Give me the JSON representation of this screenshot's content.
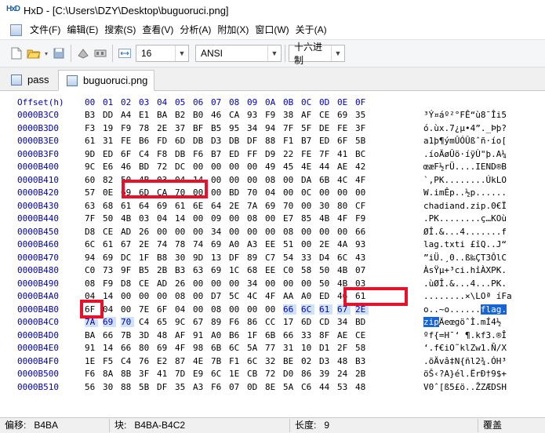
{
  "window": {
    "app_logo": "HxD",
    "title": "HxD - [C:\\Users\\DZY\\Desktop\\buguoruci.png]"
  },
  "menu": [
    "文件(F)",
    "编辑(E)",
    "搜索(S)",
    "查看(V)",
    "分析(A)",
    "附加(X)",
    "窗口(W)",
    "关于(A)"
  ],
  "toolbar": {
    "bytes_per_row": "16",
    "charset": "ANSI",
    "display_mode": "十六进制"
  },
  "tabs": [
    {
      "label": "pass",
      "active": false
    },
    {
      "label": "buguoruci.png",
      "active": true
    }
  ],
  "header": {
    "offset_label": "Offset(h)",
    "columns": [
      "00",
      "01",
      "02",
      "03",
      "04",
      "05",
      "06",
      "07",
      "08",
      "09",
      "0A",
      "0B",
      "0C",
      "0D",
      "0E",
      "0F"
    ]
  },
  "rows": [
    {
      "offset": "0000B3C0",
      "bytes": [
        "B3",
        "DD",
        "A4",
        "E1",
        "BA",
        "B2",
        "B0",
        "46",
        "CA",
        "93",
        "F9",
        "38",
        "AF",
        "CE",
        "69",
        "35"
      ],
      "ascii": "³Ý¤áº²°FÊ“ù8¯Îi5"
    },
    {
      "offset": "0000B3D0",
      "bytes": [
        "F3",
        "19",
        "F9",
        "78",
        "2E",
        "37",
        "BF",
        "B5",
        "95",
        "34",
        "94",
        "7F",
        "5F",
        "DE",
        "FE",
        "3F"
      ],
      "ascii": "ó.ùx.7¿µ•4”._Þþ?"
    },
    {
      "offset": "0000B3E0",
      "bytes": [
        "61",
        "31",
        "FE",
        "B6",
        "FD",
        "6D",
        "DB",
        "D3",
        "DB",
        "DF",
        "88",
        "F1",
        "B7",
        "ED",
        "6F",
        "5B"
      ],
      "ascii": "a1þ¶ýmÛÓÛßˆñ·ío["
    },
    {
      "offset": "0000B3F0",
      "bytes": [
        "9D",
        "ED",
        "6F",
        "C4",
        "F8",
        "DB",
        "F6",
        "B7",
        "ED",
        "FF",
        "D9",
        "22",
        "FE",
        "7F",
        "41",
        "BC"
      ],
      "ascii": ".íoÄøÛö·íÿÙ\"þ.A¼"
    },
    {
      "offset": "0000B400",
      "bytes": [
        "9C",
        "E6",
        "46",
        "BD",
        "72",
        "DC",
        "00",
        "00",
        "00",
        "00",
        "49",
        "45",
        "4E",
        "44",
        "AE",
        "42"
      ],
      "ascii": "œæF½rÜ....IEND®B"
    },
    {
      "offset": "0000B410",
      "bytes": [
        "60",
        "82",
        "50",
        "4B",
        "03",
        "04",
        "14",
        "00",
        "00",
        "00",
        "08",
        "00",
        "DA",
        "6B",
        "4C",
        "4F"
      ],
      "ascii": "`‚PK........ÚkLO"
    },
    {
      "offset": "0000B420",
      "bytes": [
        "57",
        "0E",
        "69",
        "6D",
        "CA",
        "70",
        "00",
        "00",
        "BD",
        "70",
        "04",
        "00",
        "0C",
        "00",
        "00",
        "00"
      ],
      "ascii": "W.imÊp..½p......"
    },
    {
      "offset": "0000B430",
      "bytes": [
        "63",
        "68",
        "61",
        "64",
        "69",
        "61",
        "6E",
        "64",
        "2E",
        "7A",
        "69",
        "70",
        "00",
        "30",
        "80",
        "CF"
      ],
      "ascii": "chadiand.zip.0€Ï"
    },
    {
      "offset": "0000B440",
      "bytes": [
        "7F",
        "50",
        "4B",
        "03",
        "04",
        "14",
        "00",
        "09",
        "00",
        "08",
        "00",
        "E7",
        "85",
        "4B",
        "4F",
        "F9"
      ],
      "ascii": ".PK........ç…KOù"
    },
    {
      "offset": "0000B450",
      "bytes": [
        "D8",
        "CE",
        "AD",
        "26",
        "00",
        "00",
        "00",
        "34",
        "00",
        "00",
        "00",
        "08",
        "00",
        "00",
        "00",
        "66"
      ],
      "ascii": "ØÎ.&...4.......f"
    },
    {
      "offset": "0000B460",
      "bytes": [
        "6C",
        "61",
        "67",
        "2E",
        "74",
        "78",
        "74",
        "69",
        "A0",
        "A3",
        "EE",
        "51",
        "00",
        "2E",
        "4A",
        "93"
      ],
      "ascii": "lag.txti £îQ..J“"
    },
    {
      "offset": "0000B470",
      "bytes": [
        "94",
        "69",
        "DC",
        "1F",
        "B8",
        "30",
        "9D",
        "13",
        "DF",
        "89",
        "C7",
        "54",
        "33",
        "D4",
        "6C",
        "43"
      ],
      "ascii": "”iÜ.¸0..ß‰ÇT3ÔlC"
    },
    {
      "offset": "0000B480",
      "bytes": [
        "C0",
        "73",
        "9F",
        "B5",
        "2B",
        "B3",
        "63",
        "69",
        "1C",
        "68",
        "EE",
        "C0",
        "58",
        "50",
        "4B",
        "07"
      ],
      "ascii": "ÀsŸµ+³ci.hîÀXPK."
    },
    {
      "offset": "0000B490",
      "bytes": [
        "08",
        "F9",
        "D8",
        "CE",
        "AD",
        "26",
        "00",
        "00",
        "00",
        "34",
        "00",
        "00",
        "00",
        "50",
        "4B",
        "03"
      ],
      "ascii": ".ùØÎ.&...4...PK."
    },
    {
      "offset": "0000B4A0",
      "bytes": [
        "04",
        "14",
        "00",
        "00",
        "00",
        "08",
        "00",
        "D7",
        "5C",
        "4C",
        "4F",
        "AA",
        "A0",
        "ED",
        "46",
        "61"
      ],
      "ascii": "........×\\LOª íFa"
    },
    {
      "offset": "0000B4B0",
      "bytes": [
        "6F",
        "04",
        "00",
        "7E",
        "6F",
        "04",
        "00",
        "08",
        "00",
        "00",
        "00",
        "66",
        "6C",
        "61",
        "67",
        "2E"
      ],
      "ascii_pre": "o..~o......",
      "ascii_sel": "flag.",
      "ascii_post": ""
    },
    {
      "offset": "0000B4C0",
      "bytes": [
        "7A",
        "69",
        "70",
        "C4",
        "65",
        "9C",
        "67",
        "89",
        "F6",
        "86",
        "CC",
        "17",
        "6D",
        "CD",
        "34",
        "BD"
      ],
      "ascii_pre": "",
      "ascii_sel": "zip",
      "ascii_post": "ÄeœgöˆÌ.mÍ4½"
    },
    {
      "offset": "0000B4D0",
      "bytes": [
        "BA",
        "66",
        "7B",
        "3D",
        "48",
        "AF",
        "91",
        "A0",
        "B6",
        "1F",
        "6B",
        "66",
        "33",
        "8F",
        "AE",
        "CE"
      ],
      "ascii": "ºf{=H¯‘ ¶.kf3.®Î"
    },
    {
      "offset": "0000B4E0",
      "bytes": [
        "91",
        "14",
        "66",
        "80",
        "69",
        "4F",
        "98",
        "6B",
        "6C",
        "5A",
        "77",
        "31",
        "10",
        "D1",
        "2F",
        "58"
      ],
      "ascii": "‘.f€iO˜klZw1.Ñ/X"
    },
    {
      "offset": "0000B4F0",
      "bytes": [
        "1E",
        "F5",
        "C4",
        "76",
        "E2",
        "87",
        "4E",
        "7B",
        "F1",
        "6C",
        "32",
        "BE",
        "02",
        "D3",
        "48",
        "B3"
      ],
      "ascii": ".õÄvâ‡N{ñl2¾.ÓH³"
    },
    {
      "offset": "0000B500",
      "bytes": [
        "F6",
        "8A",
        "8B",
        "3F",
        "41",
        "7D",
        "E9",
        "6C",
        "1E",
        "CB",
        "72",
        "D0",
        "86",
        "39",
        "24",
        "2B"
      ],
      "ascii": "öŠ‹?A}él.ËrÐ†9$+"
    },
    {
      "offset": "0000B510",
      "bytes": [
        "56",
        "30",
        "88",
        "5B",
        "DF",
        "35",
        "A3",
        "F6",
        "07",
        "0D",
        "8E",
        "5A",
        "C6",
        "44",
        "53",
        "48"
      ],
      "ascii": "V0ˆ[ß5£ö..ŽZÆDSH"
    }
  ],
  "status": {
    "offset_label": "偏移:",
    "offset_value": "B4BA",
    "block_label": "块:",
    "block_value": "B4BA-B4C2",
    "length_label": "长度:",
    "length_value": "9",
    "mode": "覆盖"
  },
  "colors": {
    "hex_blue": "#0000bf",
    "selection": "#cfe2f7",
    "ascii_highlight": "#1565d8",
    "annotation_red": "#e8102a"
  }
}
